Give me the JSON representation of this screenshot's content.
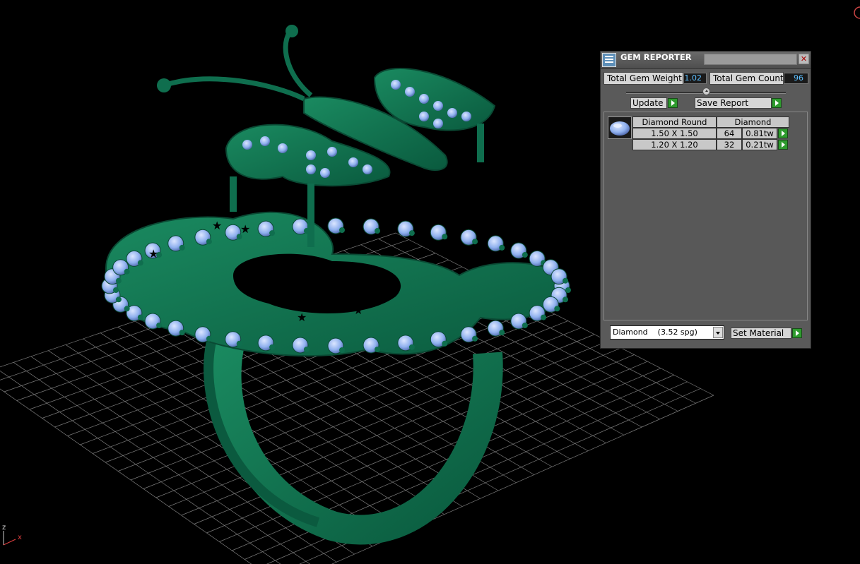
{
  "axes": {
    "z_label": "z",
    "x_label": "x"
  },
  "colors": {
    "metal": "#0f6e4e",
    "gem": "#8fb4ef",
    "grid": "#7a7a7a",
    "panel": "#5a5a5a",
    "accent_button": "#2e9b2e",
    "value_text": "#5fc0ff"
  },
  "gem_reporter": {
    "title": "GEM REPORTER",
    "close_icon": "close-icon",
    "total_gem_weight_label": "Total Gem Weight",
    "total_gem_weight_value": "1.02",
    "total_gem_count_label": "Total Gem Count",
    "total_gem_count_value": "96",
    "update_label": "Update",
    "save_report_label": "Save Report",
    "table": {
      "headers": [
        "Diamond Round",
        "Diamond"
      ],
      "rows": [
        {
          "size": "1.50 X 1.50",
          "count": "64",
          "weight": "0.81tw"
        },
        {
          "size": "1.20 X 1.20",
          "count": "32",
          "weight": "0.21tw"
        }
      ]
    },
    "material_select_value": "Diamond    (3.52 spg)",
    "set_material_label": "Set Material"
  }
}
